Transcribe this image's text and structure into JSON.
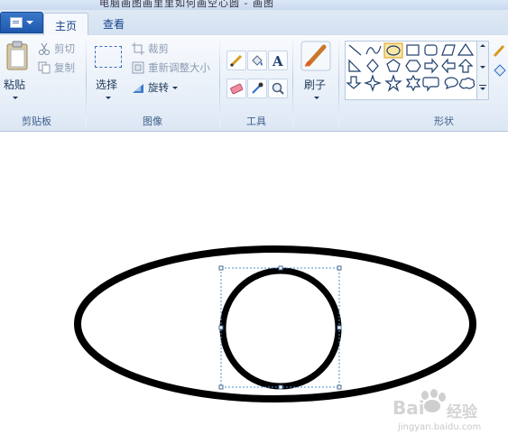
{
  "window": {
    "title_partial": "电脑画图画里里如何画空心圆 - 画图"
  },
  "tabs": {
    "file_icon": "document-menu-icon",
    "home": "主页",
    "view": "查看"
  },
  "clipboard": {
    "paste": "粘贴",
    "cut": "剪切",
    "copy": "复制",
    "group_label": "剪贴板"
  },
  "image": {
    "select": "选择",
    "crop": "裁剪",
    "resize": "重新调整大小",
    "rotate": "旋转",
    "group_label": "图像"
  },
  "tools": {
    "group_label": "工具",
    "items": [
      "pencil-icon",
      "fill-icon",
      "text-icon",
      "eraser-icon",
      "color-picker-icon",
      "magnifier-icon"
    ]
  },
  "brushes": {
    "label": "刷子"
  },
  "shapes": {
    "group_label": "形状",
    "items": [
      "line",
      "curve",
      "oval",
      "rectangle",
      "rounded-rectangle",
      "polygon",
      "triangle",
      "right-triangle",
      "diamond",
      "pentagon",
      "hexagon",
      "right-arrow",
      "left-arrow",
      "up-arrow",
      "down-arrow",
      "four-point-star",
      "five-point-star",
      "six-point-star",
      "rounded-callout",
      "oval-callout",
      "cloud-callout"
    ]
  },
  "watermark": {
    "brand": "Bai",
    "brand2": "经验",
    "url": "jingyan.baidu.com"
  },
  "colors": {
    "accent": "#1d58ad",
    "selection": "#4a8fd6",
    "ink": "#000000"
  }
}
